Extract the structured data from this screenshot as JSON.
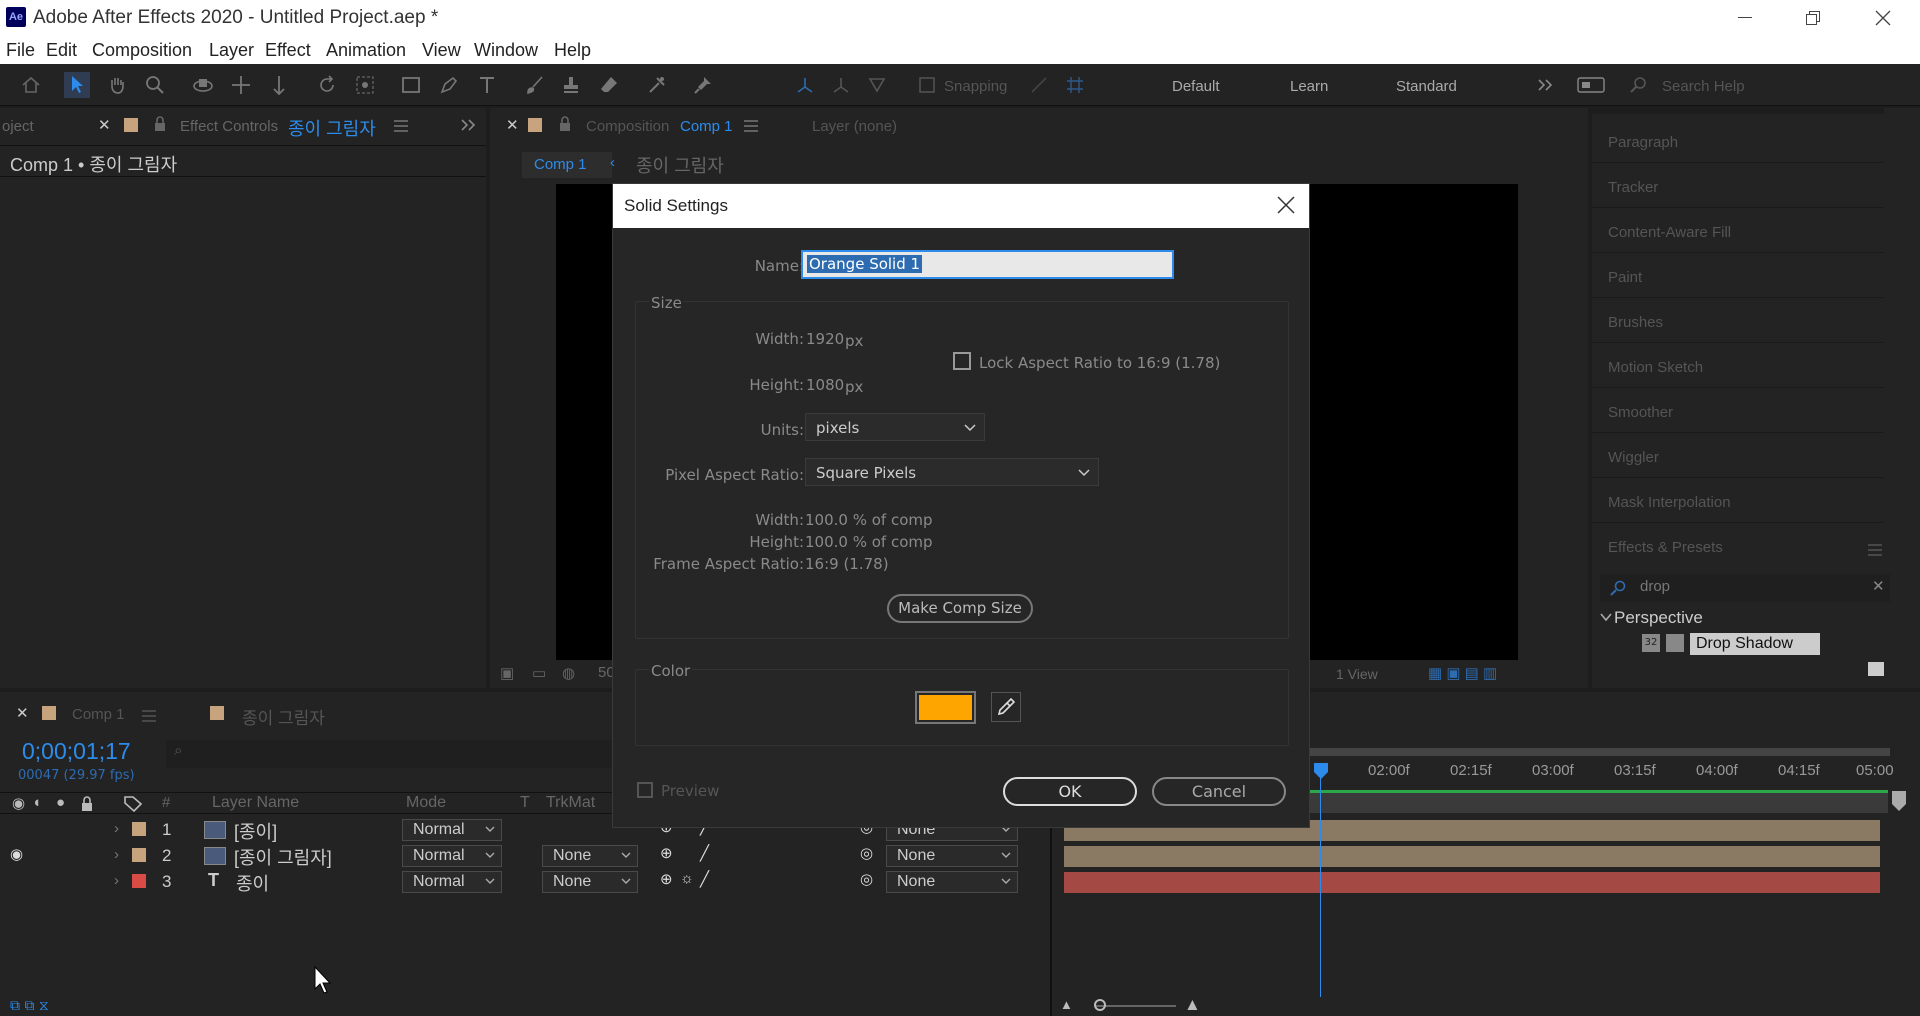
{
  "window": {
    "title": "Adobe After Effects 2020 - Untitled Project.aep *",
    "app_badge": "Ae"
  },
  "menu": [
    "File",
    "Edit",
    "Composition",
    "Layer",
    "Effect",
    "Animation",
    "View",
    "Window",
    "Help"
  ],
  "toolbar": {
    "snapping": "Snapping",
    "workspaces": [
      "Default",
      "Learn",
      "Standard"
    ],
    "search_placeholder": "Search Help"
  },
  "left_panel": {
    "tab_project": "oject",
    "tab_effect_controls": "Effect Controls",
    "tab_layer_name": "종이 그림자",
    "header": "Comp 1 • 종이 그림자"
  },
  "viewer": {
    "tab_prefix": "Composition",
    "tab_comp": "Comp 1",
    "layer_tab": "Layer (none)",
    "breadcrumb_comp": "Comp 1",
    "breadcrumb_layer": "종이 그림자",
    "views": "1 View",
    "zoom_fragment": "50"
  },
  "right_panel": {
    "items": [
      "Paragraph",
      "Tracker",
      "Content-Aware Fill",
      "Paint",
      "Brushes",
      "Motion Sketch",
      "Smoother",
      "Wiggler",
      "Mask Interpolation",
      "Effects & Presets"
    ],
    "search_value": "drop",
    "category": "Perspective",
    "effect": "Drop Shadow"
  },
  "timeline": {
    "tab_comp": "Comp 1",
    "tab_layer": "종이 그림자",
    "timecode": "0;00;01;17",
    "frame_info": "00047 (29.97 fps)",
    "columns": {
      "num": "#",
      "layer_name": "Layer Name",
      "mode": "Mode",
      "t": "T",
      "trkmat": "TrkMat"
    },
    "layers": [
      {
        "num": "1",
        "name": "[종이]",
        "mode": "Normal",
        "trkmat": "",
        "parent": "None",
        "label_color": "#c8a47e"
      },
      {
        "num": "2",
        "name": "[종이 그림자]",
        "mode": "Normal",
        "trkmat": "None",
        "parent": "None",
        "label_color": "#c8a47e"
      },
      {
        "num": "3",
        "name": "종이",
        "mode": "Normal",
        "trkmat": "None",
        "parent": "None",
        "label_color": "#d94b45"
      }
    ],
    "ruler": [
      "02:00f",
      "02:15f",
      "03:00f",
      "03:15f",
      "04:00f",
      "04:15f",
      "05:00"
    ]
  },
  "dialog": {
    "title": "Solid Settings",
    "name_label": "Name:",
    "name_value": "Orange Solid 1",
    "size_label": "Size",
    "width_label": "Width:",
    "width_value": "1920",
    "height_label": "Height:",
    "height_value": "1080",
    "unit_px": "px",
    "lock_label": "Lock Aspect Ratio to 16:9 (1.78)",
    "units_label": "Units:",
    "units_value": "pixels",
    "par_label": "Pixel Aspect Ratio:",
    "par_value": "Square Pixels",
    "comp_width_label": "Width:",
    "comp_width_value": "100.0 % of comp",
    "comp_height_label": "Height:",
    "comp_height_value": "100.0 % of comp",
    "far_label": "Frame Aspect Ratio:",
    "far_value": "16:9 (1.78)",
    "make_comp_size": "Make Comp Size",
    "color_label": "Color",
    "color_value": "#ffa500",
    "preview_label": "Preview",
    "ok": "OK",
    "cancel": "Cancel"
  },
  "colors": {
    "accent_blue": "#2d8ceb",
    "timeline_bar": "#8a7a63",
    "timeline_bar_red": "#a44944",
    "dialog_bg": "#262626"
  }
}
